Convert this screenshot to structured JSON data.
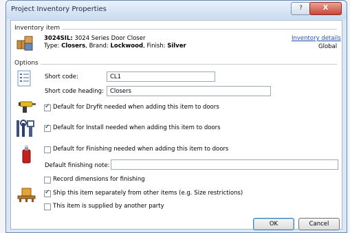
{
  "window": {
    "title": "Project Inventory Properties",
    "help_glyph": "?",
    "close_glyph": "X"
  },
  "inventory": {
    "section_label": "Inventory item",
    "code": "3024SIL:",
    "name": "3024 Series Door Closer",
    "type_label": "Type:",
    "type_value": "Closers",
    "brand_label": ", Brand:",
    "brand_value": "Lockwood",
    "finish_label": ", Finish:",
    "finish_value": "Silver",
    "details_link": "Inventory details",
    "scope": "Global",
    "icon": "boxes-icon"
  },
  "options": {
    "section_label": "Options",
    "short_code_label": "Short code:",
    "short_code_value": "CL1",
    "short_code_heading_label": "Short code heading:",
    "short_code_heading_value": "Closers",
    "dryfit_label": "Default for Dryfit needed when adding this item to doors",
    "dryfit_checked": true,
    "install_label": "Default for Install needed when adding this item to doors",
    "install_checked": true,
    "finishing_label": "Default for Finishing needed when adding this item to doors",
    "finishing_checked": false,
    "finishing_note_label": "Default finishing note:",
    "finishing_note_value": "",
    "record_dimensions_label": "Record dimensions for finishing",
    "record_dimensions_checked": false,
    "ship_separately_label": "Ship this item separately from other items (e.g. Size restrictions)",
    "ship_separately_checked": true,
    "supplied_by_other_label": "This item is supplied by another party",
    "supplied_by_other_checked": false
  },
  "buttons": {
    "ok": "OK",
    "cancel": "Cancel"
  }
}
